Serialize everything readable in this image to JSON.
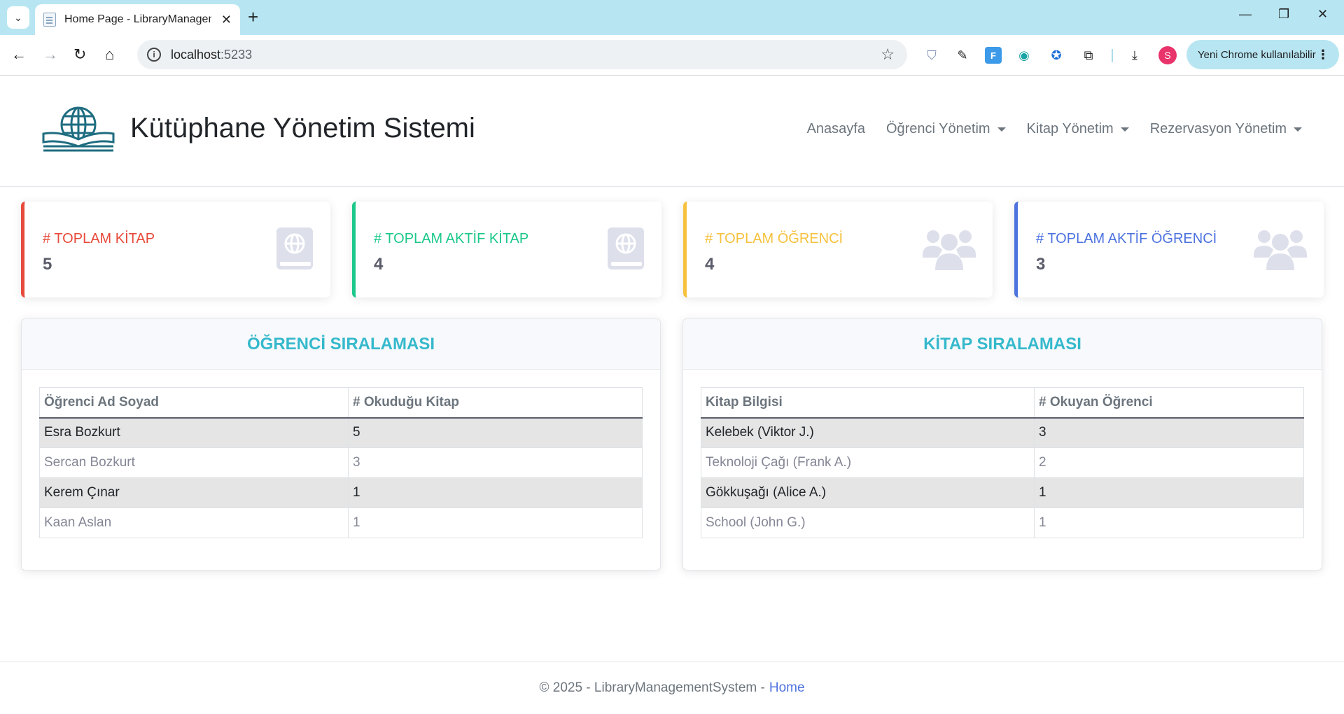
{
  "browser": {
    "tab_title": "Home Page - LibraryManagement",
    "url_host": "localhost",
    "url_port": ":5233",
    "update_label": "Yeni Chrome kullanılabilir",
    "profile_initial": "S"
  },
  "header": {
    "brand": "Kütüphane Yönetim Sistemi",
    "nav": {
      "home": "Anasayfa",
      "students": "Öğrenci Yönetim",
      "books": "Kitap Yönetim",
      "reservations": "Rezervasyon Yönetim"
    }
  },
  "stats": {
    "total_books": {
      "label": "# TOPLAM KİTAP",
      "value": "5",
      "color": "#e74a3b",
      "icon": "book-globe-icon"
    },
    "active_books": {
      "label": "# TOPLAM AKTİF KİTAP",
      "value": "4",
      "color": "#1cc88a",
      "icon": "book-globe-icon"
    },
    "total_students": {
      "label": "# TOPLAM ÖĞRENCİ",
      "value": "4",
      "color": "#f6c23e",
      "icon": "users-icon"
    },
    "active_students": {
      "label": "# TOPLAM AKTİF ÖĞRENCİ",
      "value": "3",
      "color": "#4e73df",
      "icon": "users-icon"
    }
  },
  "student_ranking": {
    "title": "ÖĞRENCİ SIRALAMASI",
    "columns": [
      "Öğrenci Ad Soyad",
      "# Okuduğu Kitap"
    ],
    "rows": [
      [
        "Esra Bozkurt",
        "5"
      ],
      [
        "Sercan Bozkurt",
        "3"
      ],
      [
        "Kerem Çınar",
        "1"
      ],
      [
        "Kaan Aslan",
        "1"
      ]
    ]
  },
  "book_ranking": {
    "title": "KİTAP SIRALAMASI",
    "columns": [
      "Kitap Bilgisi",
      "# Okuyan Öğrenci"
    ],
    "rows": [
      [
        "Kelebek (Viktor J.)",
        "3"
      ],
      [
        "Teknoloji Çağı (Frank A.)",
        "2"
      ],
      [
        "Gökkuşağı (Alice A.)",
        "1"
      ],
      [
        "School (John G.)",
        "1"
      ]
    ]
  },
  "footer": {
    "text": "© 2025 - LibraryManagementSystem -",
    "link": "Home"
  }
}
